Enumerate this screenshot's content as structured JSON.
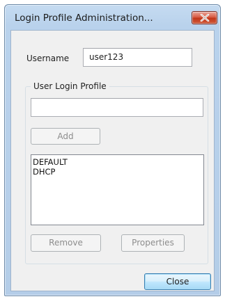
{
  "window": {
    "title": "Login Profile Administration..."
  },
  "username": {
    "label": "Username",
    "value": "user123"
  },
  "profile_group": {
    "label": "User Login Profile",
    "input_value": "",
    "add_label": "Add",
    "items": [
      "DEFAULT",
      "DHCP"
    ],
    "remove_label": "Remove",
    "properties_label": "Properties"
  },
  "footer": {
    "close_label": "Close"
  },
  "colors": {
    "close_button": "#c13519",
    "title_bar": "#b9d2ec",
    "client_bg": "#f0f0f0"
  }
}
